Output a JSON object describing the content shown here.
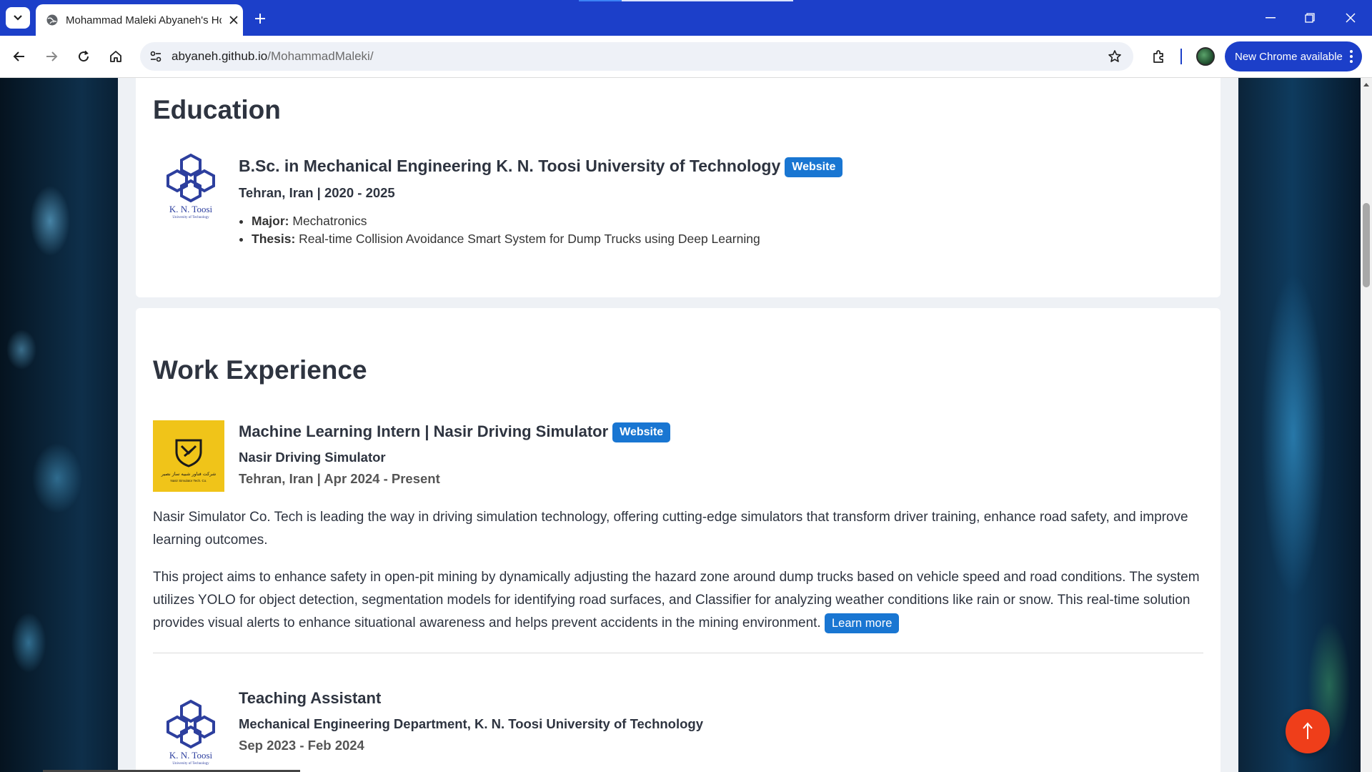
{
  "browser": {
    "tab_title": "Mohammad Maleki Abyaneh's Homepage",
    "url_host": "abyaneh.github.io",
    "url_path": "/MohammadMaleki/",
    "update_button_label": "New Chrome available",
    "accent_color": "#1c3fc9"
  },
  "education": {
    "section_title": "Education",
    "degree_title": "B.Sc. in Mechanical Engineering K. N. Toosi University of Technology",
    "website_label": "Website",
    "location_dates": "Tehran, Iran | 2020 - 2025",
    "major_label": "Major:",
    "major_value": "Mechatronics",
    "thesis_label": "Thesis:",
    "thesis_value": "Real-time Collision Avoidance Smart System for Dump Trucks using Deep Learning",
    "logo_text": "K. N. Toosi",
    "logo_subtext": "University of Technology"
  },
  "work": {
    "section_title": "Work Experience",
    "jobs": [
      {
        "title": "Machine Learning Intern | Nasir Driving Simulator",
        "website_label": "Website",
        "company": "Nasir Driving Simulator",
        "location_dates": "Tehran, Iran | Apr 2024 - Present",
        "paragraph_1": "Nasir Simulator Co. Tech is leading the way in driving simulation technology, offering cutting-edge simulators that transform driver training, enhance road safety, and improve learning outcomes.",
        "paragraph_2": "This project aims to enhance safety in open-pit mining by dynamically adjusting the hazard zone around dump trucks based on vehicle speed and road conditions. The system utilizes YOLO for object detection, segmentation models for identifying road surfaces, and Classifier for analyzing weather conditions like rain or snow. This real-time solution provides visual alerts to enhance situational awareness and helps prevent accidents in the mining environment.",
        "learn_more_label": "Learn more",
        "logo_text": "شرکت فناور شبیه ساز نصیر",
        "logo_subtext": "Nasir Simulator Tech. Co."
      },
      {
        "title": "Teaching Assistant",
        "department": "Mechanical Engineering Department, K. N. Toosi University of Technology",
        "dates": "Sep 2023 - Feb 2024",
        "logo_text": "K. N. Toosi",
        "logo_subtext": "University of Technology"
      }
    ]
  },
  "colors": {
    "badge_blue": "#1976d2",
    "fab_red": "#ef3e1a",
    "heading": "#2e3440"
  }
}
